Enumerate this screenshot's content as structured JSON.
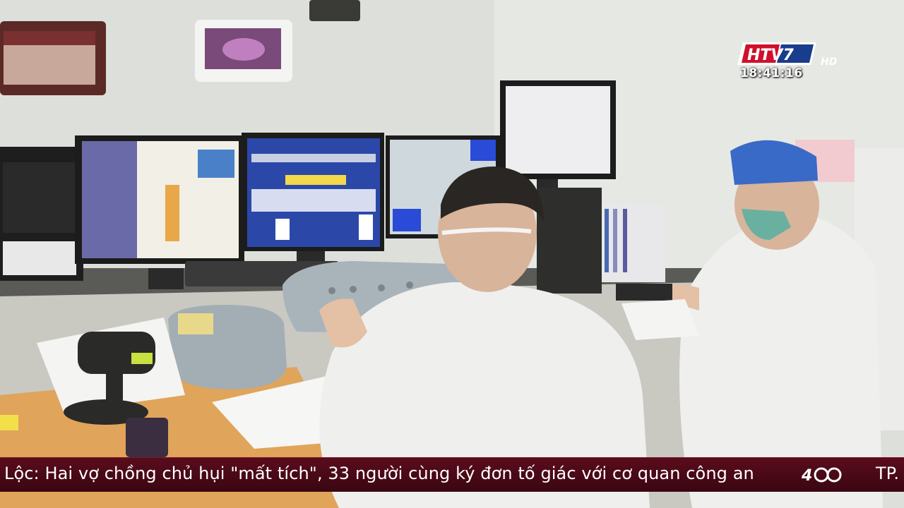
{
  "overlay": {
    "channel_logo": "HTV7",
    "channel_logo_suffix": "HD",
    "clock": "18:41:16"
  },
  "ticker": {
    "headline": "Lộc: Hai vợ chồng chủ hụi \"mất tích\", 33 người cùng ký đơn tố giác với cơ quan công an",
    "next_prefix": "TP."
  },
  "colors": {
    "ticker_bg": "#4a0918",
    "logo_red": "#d0102a",
    "logo_blue": "#1a3c8c",
    "wall": "#dfe2dc"
  },
  "icons": [
    "channel-logo-icon",
    "anniversary-emblem-icon"
  ]
}
